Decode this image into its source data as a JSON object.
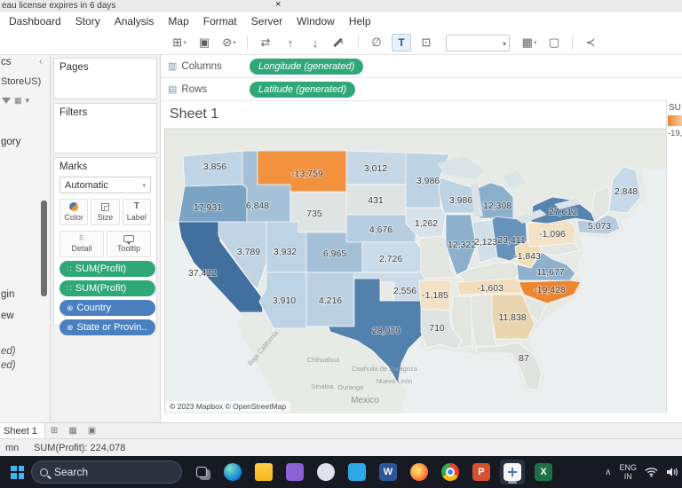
{
  "banner": {
    "text": "eau license expires in 6 days"
  },
  "menu": {
    "items": [
      "Dashboard",
      "Story",
      "Analysis",
      "Map",
      "Format",
      "Server",
      "Window",
      "Help"
    ]
  },
  "toolbar": {
    "fit_value": ""
  },
  "data_pane": {
    "tab_fragment": "cs",
    "source_fragment": "StoreUS)",
    "fields": [
      {
        "text": "gory",
        "italic": false
      },
      {
        "text": "gin",
        "italic": false
      },
      {
        "text": "ew",
        "italic": false
      },
      {
        "text": "ed)",
        "italic": true
      },
      {
        "text": "ed)",
        "italic": true
      }
    ]
  },
  "cards": {
    "pages": {
      "title": "Pages"
    },
    "filters": {
      "title": "Filters"
    },
    "marks": {
      "title": "Marks",
      "type": "Automatic",
      "buttons": [
        {
          "label": "Color"
        },
        {
          "label": "Size"
        },
        {
          "label": "Label"
        },
        {
          "label": "Detail"
        },
        {
          "label": "Tooltip"
        }
      ],
      "pills": [
        {
          "label": "SUM(Profit)",
          "color": "#2fa878",
          "kind": "measure"
        },
        {
          "label": "SUM(Profit)",
          "color": "#2fa878",
          "kind": "measure"
        },
        {
          "label": "Country",
          "color": "#4a80c0",
          "kind": "geo"
        },
        {
          "label": "State or Provin..",
          "color": "#4a80c0",
          "kind": "geo"
        }
      ]
    }
  },
  "shelves": {
    "columns_label": "Columns",
    "columns_pill": "Longitude (generated)",
    "rows_label": "Rows",
    "rows_pill": "Latitude (generated)",
    "pill_color": "#2fa878"
  },
  "sheet": {
    "title": "Sheet 1"
  },
  "map": {
    "attribution": "© 2023 Mapbox © OpenStreetMap",
    "geo_labels": [
      "Baja California",
      "Chihuahua",
      "Coahuila de Zaragoza",
      "Sinaloa",
      "Durango",
      "Nuevo León",
      "Mexico"
    ],
    "states": [
      {
        "id": "WA",
        "value": "3,856",
        "fill": "#bfd4e4"
      },
      {
        "id": "OR",
        "value": "17,931",
        "fill": "#7ba3c4"
      },
      {
        "id": "CA",
        "value": "37,422",
        "fill": "#41709e"
      },
      {
        "id": "NV",
        "value": "3,789",
        "fill": "#c0d4e4"
      },
      {
        "id": "ID",
        "value": "6,848",
        "fill": "#a5c1d7"
      },
      {
        "id": "MT",
        "value": "-13,759",
        "fill": "#f2913e"
      },
      {
        "id": "WY",
        "value": "735",
        "fill": "#dfe3e2"
      },
      {
        "id": "UT",
        "value": "3,932",
        "fill": "#bed3e3"
      },
      {
        "id": "CO",
        "value": "6,965",
        "fill": "#a3c0d6"
      },
      {
        "id": "AZ",
        "value": "3,910",
        "fill": "#bed3e3"
      },
      {
        "id": "NM",
        "value": "4,216",
        "fill": "#bbd1e2"
      },
      {
        "id": "ND",
        "value": "3,012",
        "fill": "#c6d8e6"
      },
      {
        "id": "SD",
        "value": "431",
        "fill": "#e0e3e1"
      },
      {
        "id": "NE",
        "value": "4,676",
        "fill": "#b7cee0"
      },
      {
        "id": "KS",
        "value": "2,726",
        "fill": "#cbdbe8"
      },
      {
        "id": "OK",
        "value": "2,556",
        "fill": "#cddce8"
      },
      {
        "id": "TX",
        "value": "28,079",
        "fill": "#5181ac"
      },
      {
        "id": "MN",
        "value": "3,986",
        "fill": "#bdd2e3"
      },
      {
        "id": "IA",
        "value": "1,262",
        "fill": "#d8e2ea"
      },
      {
        "id": "WI",
        "value": "3,986",
        "fill": "#bdd2e3"
      },
      {
        "id": "IL",
        "value": "12,322",
        "fill": "#8cafcc"
      },
      {
        "id": "IN",
        "value": "2,123",
        "fill": "#d1dfe9"
      },
      {
        "id": "MI",
        "value": "12,308",
        "fill": "#8cafcc"
      },
      {
        "id": "OH",
        "value": "23,411",
        "fill": "#6792b9"
      },
      {
        "id": "WV",
        "value": "-1,843",
        "fill": "#f0dcb7"
      },
      {
        "id": "PA",
        "value": "-1,096",
        "fill": "#f2e2c6"
      },
      {
        "id": "NY",
        "value": "27,612",
        "fill": "#5584af"
      },
      {
        "id": "VA",
        "value": "11,677",
        "fill": "#8fb1ce"
      },
      {
        "id": "NC",
        "value": "-19,428",
        "fill": "#ed8630"
      },
      {
        "id": "TN",
        "value": "-1,603",
        "fill": "#f1ddba"
      },
      {
        "id": "AR",
        "value": "-1,185",
        "fill": "#f2e1c4"
      },
      {
        "id": "LA",
        "value": "710",
        "fill": "#dfe3e2"
      },
      {
        "id": "GA",
        "value": "11,838",
        "fill": "#e9d5ae"
      },
      {
        "id": "FL",
        "value": "87",
        "fill": "#e1e3e0"
      },
      {
        "id": "ME",
        "value": "2,848",
        "fill": "#c8d9e7"
      },
      {
        "id": "MA",
        "value": "5,073",
        "fill": "#b3cbde"
      }
    ]
  },
  "legend": {
    "title_fragment": "SU",
    "min_fragment": "-19,4",
    "gradient": [
      "#ed8630",
      "#f8cfa0"
    ]
  },
  "tabs": {
    "sheet": "Sheet 1"
  },
  "status": {
    "left_fragment": "mn",
    "summary": "SUM(Profit): 224,078"
  },
  "taskbar": {
    "search": "Search",
    "tray_lang_top": "ENG",
    "tray_lang_bottom": "IN",
    "apps": [
      {
        "name": "task-view"
      },
      {
        "name": "edge"
      },
      {
        "name": "file-explorer"
      },
      {
        "name": "app-purple"
      },
      {
        "name": "app-light"
      },
      {
        "name": "vscode"
      },
      {
        "name": "word",
        "letter": "W"
      },
      {
        "name": "firefox"
      },
      {
        "name": "chrome"
      },
      {
        "name": "powerpoint",
        "letter": "P"
      },
      {
        "name": "tableau",
        "active": true
      },
      {
        "name": "excel",
        "letter": "X"
      }
    ]
  }
}
